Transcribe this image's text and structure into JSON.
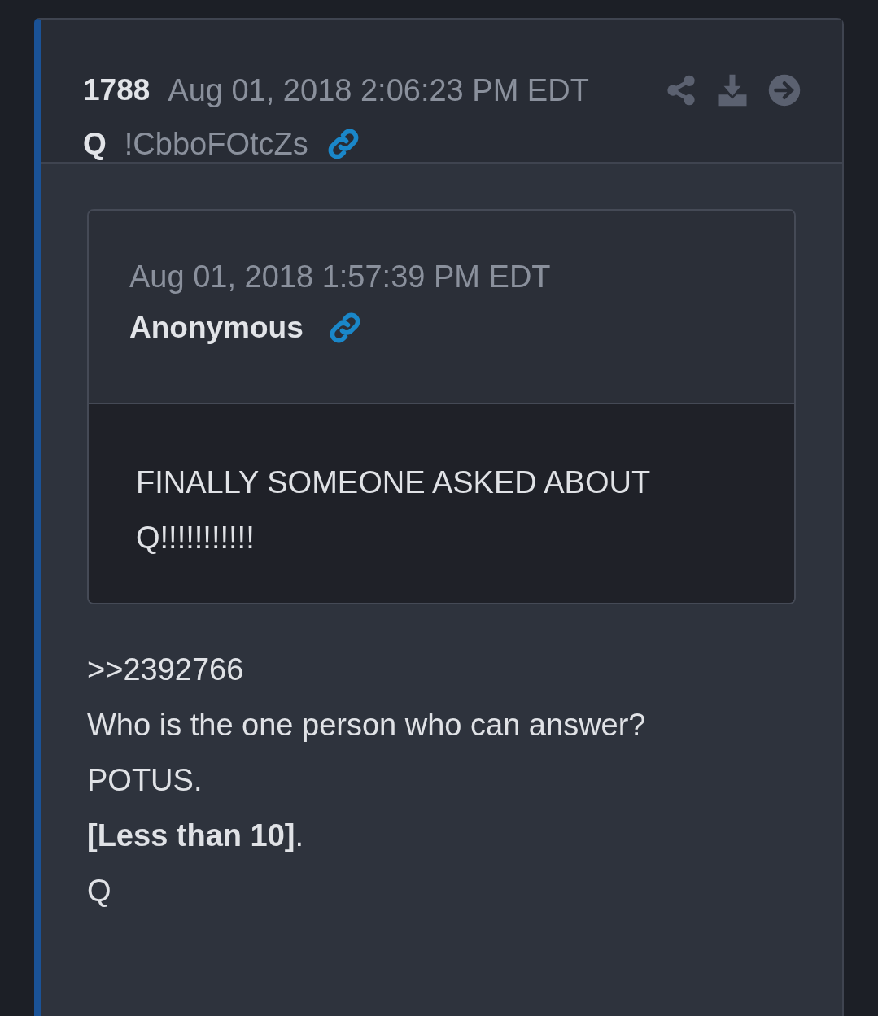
{
  "post": {
    "number": "1788",
    "timestamp": "Aug 01, 2018 2:06:23 PM EDT",
    "author": "Q",
    "tripcode": "!CbboFOtcZs"
  },
  "quote": {
    "timestamp": "Aug 01, 2018 1:57:39 PM EDT",
    "author": "Anonymous",
    "lines": [
      "FINALLY SOMEONE ASKED ABOUT",
      "Q!!!!!!!!!!!"
    ]
  },
  "body_lines": [
    ">>2392766",
    "Who is the one person who can answer?",
    "POTUS.",
    "**[Less than 10]**.",
    "Q"
  ]
}
